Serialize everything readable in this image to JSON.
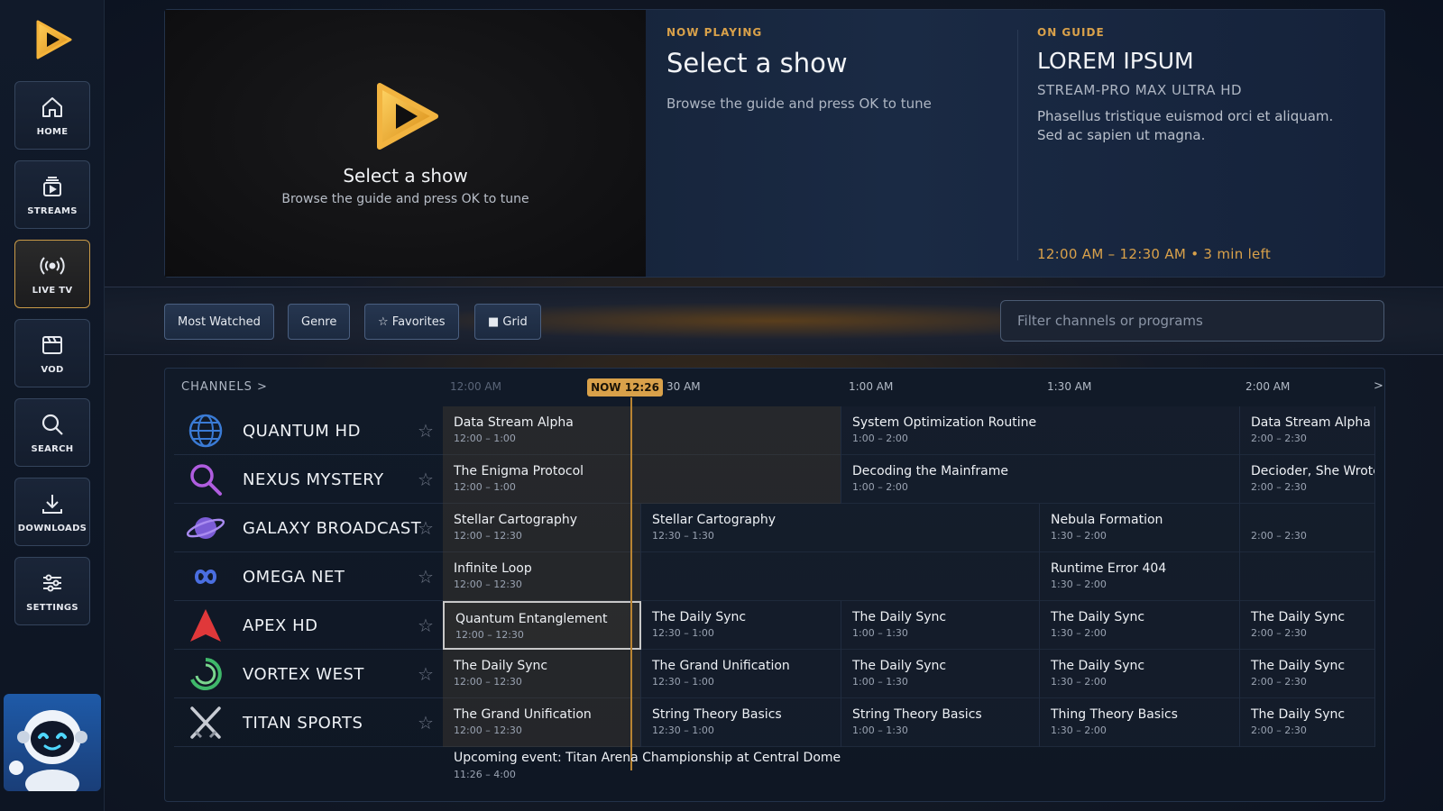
{
  "sidebar": {
    "items": [
      {
        "label": "HOME",
        "icon": "home-icon"
      },
      {
        "label": "STREAMS",
        "icon": "streams-icon"
      },
      {
        "label": "LIVE TV",
        "icon": "live-tv-icon"
      },
      {
        "label": "VOD",
        "icon": "vod-icon"
      },
      {
        "label": "SEARCH",
        "icon": "search-icon"
      },
      {
        "label": "DOWNLOADS",
        "icon": "download-icon"
      },
      {
        "label": "SETTINGS",
        "icon": "settings-icon"
      }
    ],
    "active": "LIVE TV"
  },
  "preview": {
    "title": "Select a show",
    "subtitle": "Browse the guide and press OK to tune"
  },
  "now_playing": {
    "label": "NOW PLAYING",
    "title": "Select a show",
    "subtitle": "Browse the guide and press OK to tune"
  },
  "on_guide": {
    "label": "ON GUIDE",
    "title": "LOREM IPSUM",
    "subtitle": "STREAM-PRO MAX ULTRA HD",
    "description": "Phasellus tristique euismod orci et aliquam. Sed ac sapien ut magna.",
    "time": "12:00 AM – 12:30 AM  •  3 min left"
  },
  "filters": {
    "most_watched": "Most Watched",
    "genre": "Genre",
    "favorites": "☆ Favorites",
    "grid": "■ Grid",
    "search_placeholder": "Filter channels or programs"
  },
  "guide": {
    "channels_label": "CHANNELS  >",
    "now_badge": "NOW 12:26",
    "next_arrow": ">",
    "ticks": [
      "12:00 AM",
      "30 AM",
      "1:00 AM",
      "1:30 AM",
      "2:00 AM"
    ],
    "channels": [
      {
        "name": "QUANTUM HD",
        "logo": "globe-logo",
        "star": "☆"
      },
      {
        "name": "NEXUS MYSTERY",
        "logo": "magnifier-logo",
        "star": "☆"
      },
      {
        "name": "GALAXY BROADCAST",
        "logo": "planet-logo",
        "star": "☆"
      },
      {
        "name": "OMEGA NET",
        "logo": "infinity-logo",
        "star": "☆"
      },
      {
        "name": "APEX HD",
        "logo": "triangle-logo",
        "star": "☆"
      },
      {
        "name": "VORTEX WEST",
        "logo": "swirl-logo",
        "star": "☆"
      },
      {
        "name": "TITAN SPORTS",
        "logo": "swords-logo",
        "star": "☆"
      }
    ],
    "programs": [
      [
        {
          "title": "Data Stream Alpha",
          "time": "12:00 – 1:00"
        },
        {
          "title": "System Optimization Routine",
          "time": "1:00 – 2:00"
        },
        {
          "title": "Data Stream Alpha",
          "time": "2:00 – 2:30"
        }
      ],
      [
        {
          "title": "The Enigma Protocol",
          "time": "12:00 – 1:00"
        },
        {
          "title": "Decoding the Mainframe",
          "time": "1:00 – 2:00"
        },
        {
          "title": "Decioder, She Wrote",
          "time": "2:00 – 2:30"
        }
      ],
      [
        {
          "title": "Stellar Cartography",
          "time": "12:00 – 12:30"
        },
        {
          "title": "Stellar Cartography",
          "time": "12:30 – 1:30"
        },
        {
          "title": "Nebula Formation",
          "time": "1:30 – 2:00"
        },
        {
          "title": "",
          "time": "2:00 – 2:30"
        }
      ],
      [
        {
          "title": "Infinite Loop",
          "time": "12:00 – 12:30"
        },
        {
          "title": "",
          "time": ""
        },
        {
          "title": "Runtime Error 404",
          "time": "1:30 – 2:00"
        },
        {
          "title": "",
          "time": ""
        }
      ],
      [
        {
          "title": "Quantum Entanglement",
          "time": "12:00 – 12:30"
        },
        {
          "title": "The Daily Sync",
          "time": "12:30 – 1:00"
        },
        {
          "title": "The Daily Sync",
          "time": "1:00 – 1:30"
        },
        {
          "title": "The Daily Sync",
          "time": "1:30 – 2:00"
        },
        {
          "title": "The Daily Sync",
          "time": "2:00 – 2:30"
        }
      ],
      [
        {
          "title": "The Daily Sync",
          "time": "12:00 – 12:30"
        },
        {
          "title": "The Grand Unification",
          "time": "12:30 – 1:00"
        },
        {
          "title": "The Daily Sync",
          "time": "1:00 – 1:30"
        },
        {
          "title": "The Daily Sync",
          "time": "1:30 – 2:00"
        },
        {
          "title": "The Daily Sync",
          "time": "2:00 – 2:30"
        }
      ],
      [
        {
          "title": "The Grand Unification",
          "time": "12:00 – 12:30"
        },
        {
          "title": "String Theory Basics",
          "time": "12:30 – 1:00"
        },
        {
          "title": "String Theory Basics",
          "time": "1:00 – 1:30"
        },
        {
          "title": "Thing Theory Basics",
          "time": "1:30 – 2:00"
        },
        {
          "title": "The Daily Sync",
          "time": "2:00 – 2:30"
        }
      ]
    ],
    "event": {
      "title": "Upcoming event: Titan Arena Championship at Central Dome",
      "time": "11:26 – 4:00"
    }
  },
  "colors": {
    "accent": "#d9a14a",
    "background": "#0b1220",
    "panel": "#111a28"
  }
}
